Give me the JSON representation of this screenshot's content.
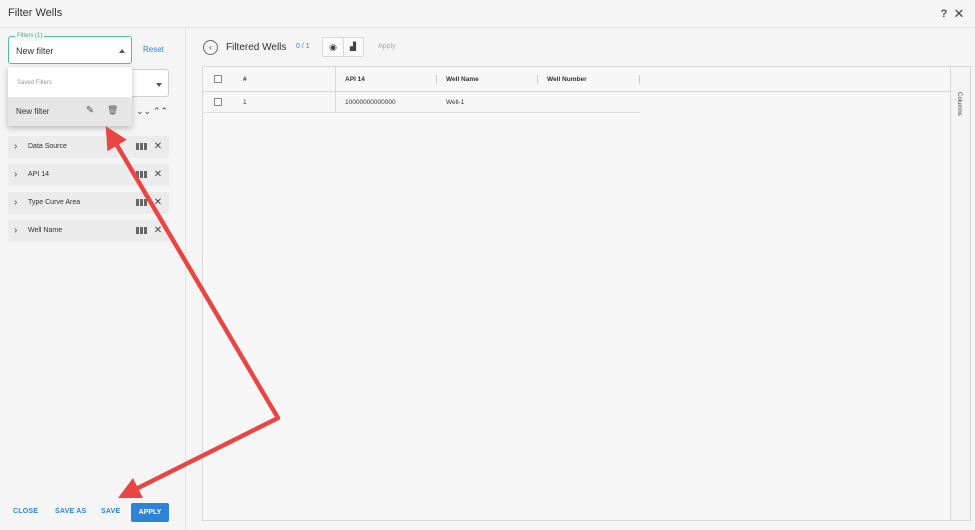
{
  "window": {
    "title": "Filter Wells"
  },
  "left": {
    "filter_legend": "Filters (1)",
    "filter_value": "New filter",
    "reset_label": "Reset",
    "dropdown": {
      "header": "Saved Filters",
      "items": [
        {
          "label": "New filter"
        }
      ]
    },
    "filters": [
      {
        "label": "Data Source"
      },
      {
        "label": "API 14"
      },
      {
        "label": "Type Curve Area"
      },
      {
        "label": "Well Name"
      }
    ],
    "footer": {
      "close_label": "CLOSE",
      "save_as_label": "SAVE AS",
      "save_label": "SAVE",
      "apply_label": "APPLY"
    }
  },
  "main": {
    "title": "Filtered Wells",
    "count": "0 / 1",
    "apply_label": "Apply",
    "grid": {
      "columns": [
        "#",
        "API 14",
        "Well Name",
        "Well Number"
      ],
      "rows": [
        {
          "index": "1",
          "api14": "10000000000000",
          "well_name": "Well-1",
          "well_number": ""
        }
      ],
      "side_label": "Columns"
    }
  },
  "icons": {
    "help": "help-icon",
    "close": "close-icon",
    "edit": "edit-icon",
    "trash": "trash-icon",
    "back": "chevron-left-icon",
    "globe": "globe-icon",
    "chart": "chart-icon"
  },
  "colors": {
    "accent": "#2d84d6",
    "focus_border": "#4fc3a1",
    "annotation_arrow": "#e84545"
  }
}
